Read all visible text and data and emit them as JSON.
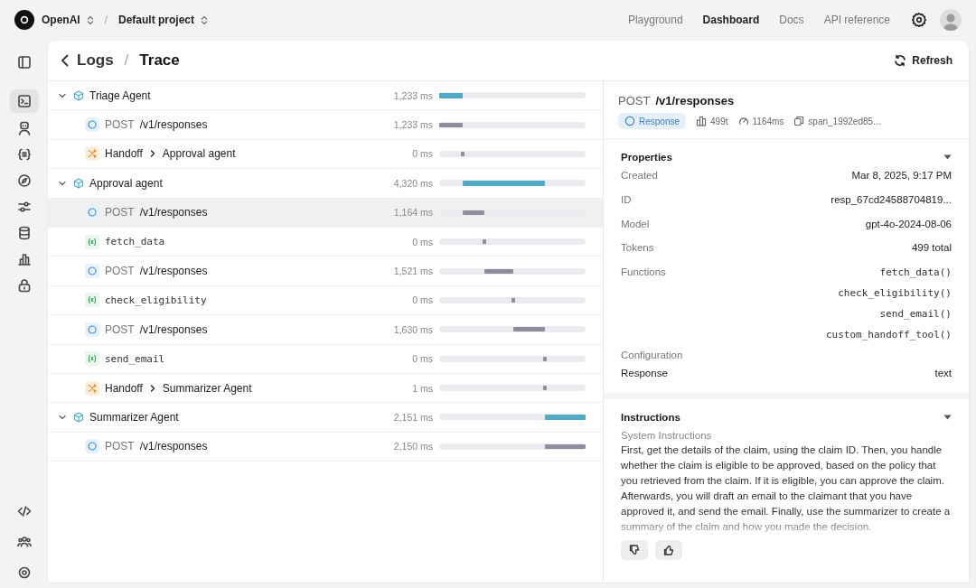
{
  "topbar": {
    "org": "OpenAI",
    "separator": "/",
    "project": "Default project",
    "nav": [
      {
        "label": "Playground",
        "selected": false
      },
      {
        "label": "Dashboard",
        "selected": true
      },
      {
        "label": "Docs",
        "selected": false
      },
      {
        "label": "API reference",
        "selected": false
      }
    ]
  },
  "sidebar": {
    "items": [
      {
        "selected": true
      },
      {
        "selected": false
      },
      {
        "selected": false
      },
      {
        "selected": false
      },
      {
        "selected": false
      },
      {
        "selected": false
      },
      {
        "selected": false
      },
      {
        "selected": false
      }
    ],
    "footer_items": [
      {
        "selected": false
      },
      {
        "selected": false
      },
      {
        "selected": false
      }
    ]
  },
  "breadcrumb": {
    "items": [
      "Logs",
      "Trace"
    ],
    "separator": "/"
  },
  "refresh": "Refresh",
  "trace": [
    {
      "kind": "agent",
      "name": "Triage Agent",
      "duration": "1,233 ms",
      "expanded": true,
      "selected": false,
      "children": [
        {
          "kind": "request",
          "method": "POST",
          "path": "/v1/responses",
          "duration": "1,233 ms",
          "selected": false
        },
        {
          "kind": "handoff",
          "label": "Handoff",
          "target": "Approval agent",
          "duration": "0 ms",
          "selected": false
        }
      ]
    },
    {
      "kind": "agent",
      "name": "Approval agent",
      "duration": "4,320 ms",
      "expanded": true,
      "selected": false,
      "children": [
        {
          "kind": "request",
          "method": "POST",
          "path": "/v1/responses",
          "duration": "1,164 ms",
          "selected": true
        },
        {
          "kind": "function",
          "name": "fetch_data",
          "duration": "0 ms",
          "selected": false
        },
        {
          "kind": "request",
          "method": "POST",
          "path": "/v1/responses",
          "duration": "1,521 ms",
          "selected": false
        },
        {
          "kind": "function",
          "name": "check_eligibility",
          "duration": "0 ms",
          "selected": false
        },
        {
          "kind": "request",
          "method": "POST",
          "path": "/v1/responses",
          "duration": "1,630 ms",
          "selected": false
        },
        {
          "kind": "function",
          "name": "send_email",
          "duration": "0 ms",
          "selected": false
        },
        {
          "kind": "handoff",
          "label": "Handoff",
          "target": "Summarizer Agent",
          "duration": "1 ms",
          "selected": false
        }
      ]
    },
    {
      "kind": "agent",
      "name": "Summarizer Agent",
      "duration": "2,151 ms",
      "expanded": true,
      "selected": false,
      "children": [
        {
          "kind": "request",
          "method": "POST",
          "path": "/v1/responses",
          "duration": "2,150 ms",
          "selected": false
        }
      ]
    }
  ],
  "detail": {
    "method": "POST",
    "path": "/v1/responses",
    "badge": "Response",
    "tokens": "499t",
    "time": "1164ms",
    "span": "span_1992ed85...",
    "properties": {
      "title": "Properties",
      "expanded": true,
      "rows": [
        {
          "label": "Created",
          "value": "Mar 8, 2025, 9:17 PM"
        },
        {
          "label": "ID",
          "value": "resp_67cd24588704819..."
        },
        {
          "label": "Model",
          "value": "gpt-4o-2024-08-06"
        },
        {
          "label": "Tokens",
          "value": "499 total"
        }
      ],
      "functions_label": "Functions",
      "functions": [
        "fetch_data()",
        "check_eligibility()",
        "send_email()",
        "custom_handoff_tool()"
      ],
      "configuration_label": "Configuration",
      "configuration": [
        {
          "label": "Response",
          "value": "text"
        }
      ]
    },
    "instructions": {
      "title": "Instructions",
      "expanded": true,
      "subtitle": "System Instructions",
      "text": "First, get the details of the claim, using the claim ID. Then, you handle whether the claim is eligible to be approved, based on the policy that you retrieved from the claim. If it is eligible, you can approve the claim. Afterwards, you will draft an email to the claimant that you have approved it, and send the email. Finally, use the summarizer to create a summary of the claim and how you made the decision."
    }
  }
}
